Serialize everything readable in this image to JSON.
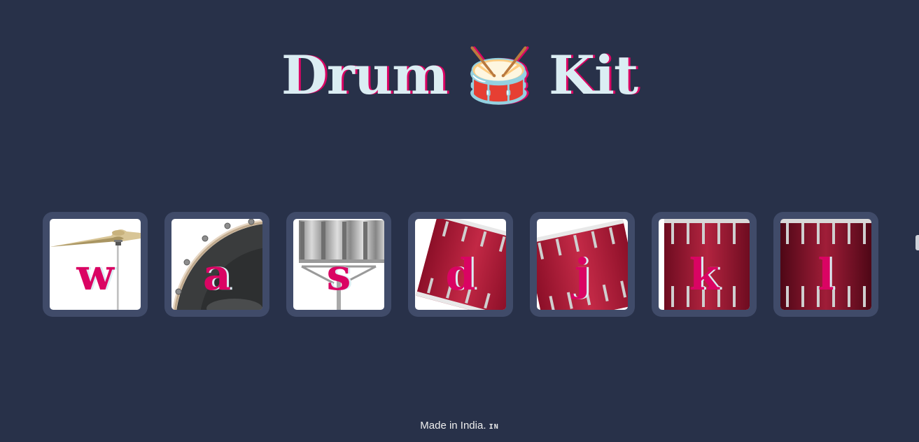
{
  "page": {
    "title": "Drum 🥁 Kit"
  },
  "drums": [
    {
      "key": "w",
      "instrument": "crash-cymbal"
    },
    {
      "key": "a",
      "instrument": "kick-drum"
    },
    {
      "key": "s",
      "instrument": "snare"
    },
    {
      "key": "d",
      "instrument": "tom-1"
    },
    {
      "key": "j",
      "instrument": "tom-2"
    },
    {
      "key": "k",
      "instrument": "tom-3"
    },
    {
      "key": "l",
      "instrument": "tom-4"
    }
  ],
  "footer": {
    "text": "Made in India.",
    "flag": "IN"
  },
  "colors": {
    "background": "#283149",
    "tile": "#404b69",
    "accent": "#da0463",
    "title": "#dbedf3"
  }
}
